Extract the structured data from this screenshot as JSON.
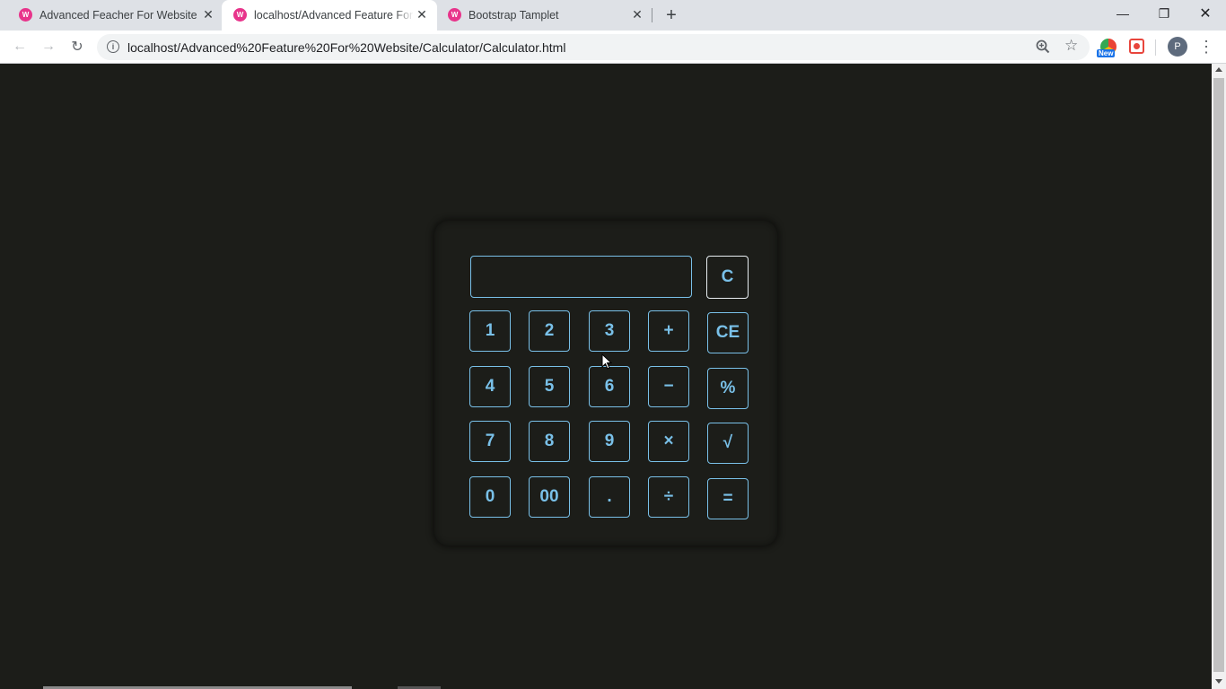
{
  "browser": {
    "tabs": [
      {
        "title": "Advanced Feacher For Website",
        "favicon": "W"
      },
      {
        "title": "localhost/Advanced Feature For Web",
        "favicon": "W",
        "active": true
      },
      {
        "title": "Bootstrap Tamplet",
        "favicon": "W"
      }
    ],
    "url": "localhost/Advanced%20Feature%20For%20Website/Calculator/Calculator.html",
    "extension_badge": "New",
    "profile_initial": "P"
  },
  "calculator": {
    "display_value": "",
    "clear_label": "C",
    "rows": [
      [
        "1",
        "2",
        "3",
        "+",
        "CE"
      ],
      [
        "4",
        "5",
        "6",
        "−",
        "%"
      ],
      [
        "7",
        "8",
        "9",
        "×",
        "√"
      ],
      [
        "0",
        "00",
        ".",
        "÷",
        "="
      ]
    ]
  },
  "colors": {
    "background": "#1c1d19",
    "accent": "#79c0e8",
    "tab_favicon": "#e8348b"
  }
}
